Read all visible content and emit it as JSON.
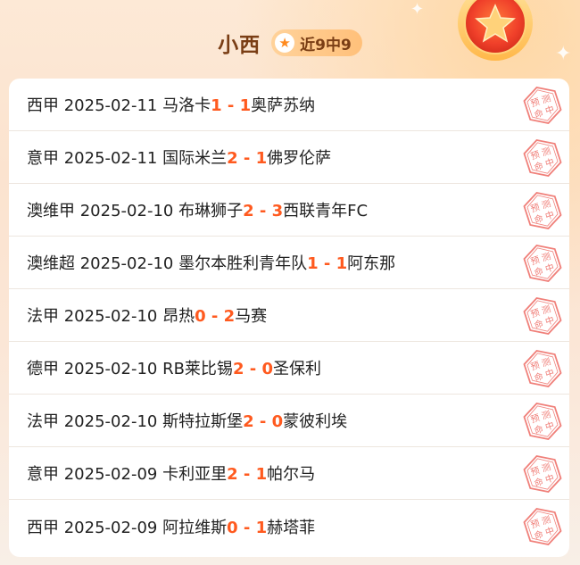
{
  "header": {
    "name": "小西",
    "record": "近9中9"
  },
  "stamp_text": [
    "预",
    "测",
    "命",
    "中"
  ],
  "colors": {
    "score": "#ff5a1f",
    "stamp": "#f0807a",
    "title": "#7a3e15"
  },
  "matches": [
    {
      "league": "西甲",
      "date": "2025-02-11",
      "home": "马洛卡",
      "home_score": "1",
      "dash": " - ",
      "away_score": "1",
      "away": "奥萨苏纳"
    },
    {
      "league": "意甲",
      "date": "2025-02-11",
      "home": "国际米兰",
      "home_score": "2",
      "dash": " - ",
      "away_score": "1",
      "away": "佛罗伦萨"
    },
    {
      "league": "澳维甲",
      "date": "2025-02-10",
      "home": "布琳狮子",
      "home_score": "2",
      "dash": " - ",
      "away_score": "3",
      "away": "西联青年FC"
    },
    {
      "league": "澳维超",
      "date": "2025-02-10",
      "home": "墨尔本胜利青年队",
      "home_score": "1",
      "dash": " - ",
      "away_score": "1",
      "away": "阿东那"
    },
    {
      "league": "法甲",
      "date": "2025-02-10",
      "home": "昂热",
      "home_score": "0",
      "dash": " - ",
      "away_score": "2",
      "away": "马赛"
    },
    {
      "league": "德甲",
      "date": "2025-02-10",
      "home": "RB莱比锡",
      "home_score": "2",
      "dash": " - ",
      "away_score": "0",
      "away": "圣保利"
    },
    {
      "league": "法甲",
      "date": "2025-02-10",
      "home": "斯特拉斯堡",
      "home_score": "2",
      "dash": " - ",
      "away_score": "0",
      "away": "蒙彼利埃"
    },
    {
      "league": "意甲",
      "date": "2025-02-09",
      "home": "卡利亚里",
      "home_score": "2",
      "dash": " - ",
      "away_score": "1",
      "away": "帕尔马"
    },
    {
      "league": "西甲",
      "date": "2025-02-09",
      "home": "阿拉维斯",
      "home_score": "0",
      "dash": " - ",
      "away_score": "1",
      "away": "赫塔菲"
    }
  ]
}
